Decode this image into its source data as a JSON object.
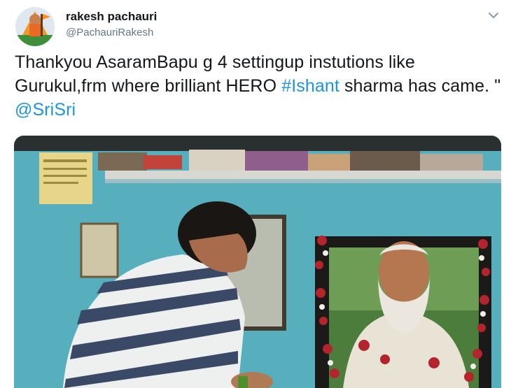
{
  "tweet": {
    "author_name": "rakesh pachauri",
    "author_handle": "@PachauriRakesh",
    "text_before": "Thankyou AsaramBapu g 4 settingup instutions like Gurukul,frm where brilliant HERO ",
    "hashtag": "#Ishant",
    "text_middle": " sharma has came. \" ",
    "mention": "@SriSri",
    "menu_icon": "chevron-down-icon"
  },
  "media": {
    "description": ""
  }
}
